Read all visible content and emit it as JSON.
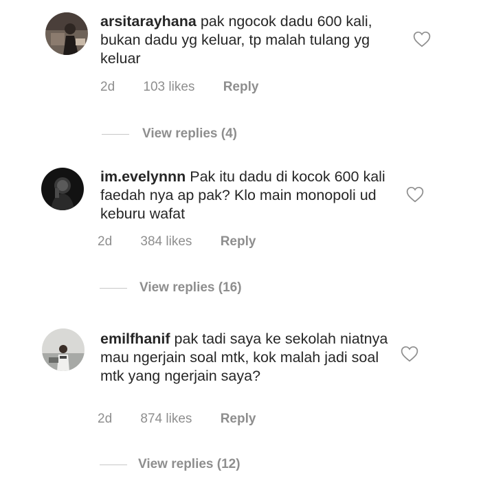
{
  "comments": [
    {
      "username": "arsitarayhana",
      "text": "pak ngocok dadu 600 kali, bukan dadu yg keluar, tp malah tulang yg keluar",
      "time": "2d",
      "likes": "103 likes",
      "reply_label": "Reply",
      "view_replies": "View replies (4)"
    },
    {
      "username": "im.evelynnn",
      "text": "Pak itu dadu di kocok 600 kali faedah nya ap pak? Klo main monopoli ud keburu wafat",
      "time": "2d",
      "likes": "384 likes",
      "reply_label": "Reply",
      "view_replies": "View replies (16)"
    },
    {
      "username": "emilfhanif",
      "text": "pak tadi saya ke sekolah niatnya mau ngerjain soal mtk, kok malah jadi soal mtk yang ngerjain saya?",
      "time": "2d",
      "likes": "874 likes",
      "reply_label": "Reply",
      "view_replies": "View replies (12)"
    }
  ],
  "colors": {
    "text": "#262626",
    "secondary": "#8e8e8e",
    "divider": "#c7c7c7"
  },
  "icons": [
    "heart-outline-icon"
  ]
}
